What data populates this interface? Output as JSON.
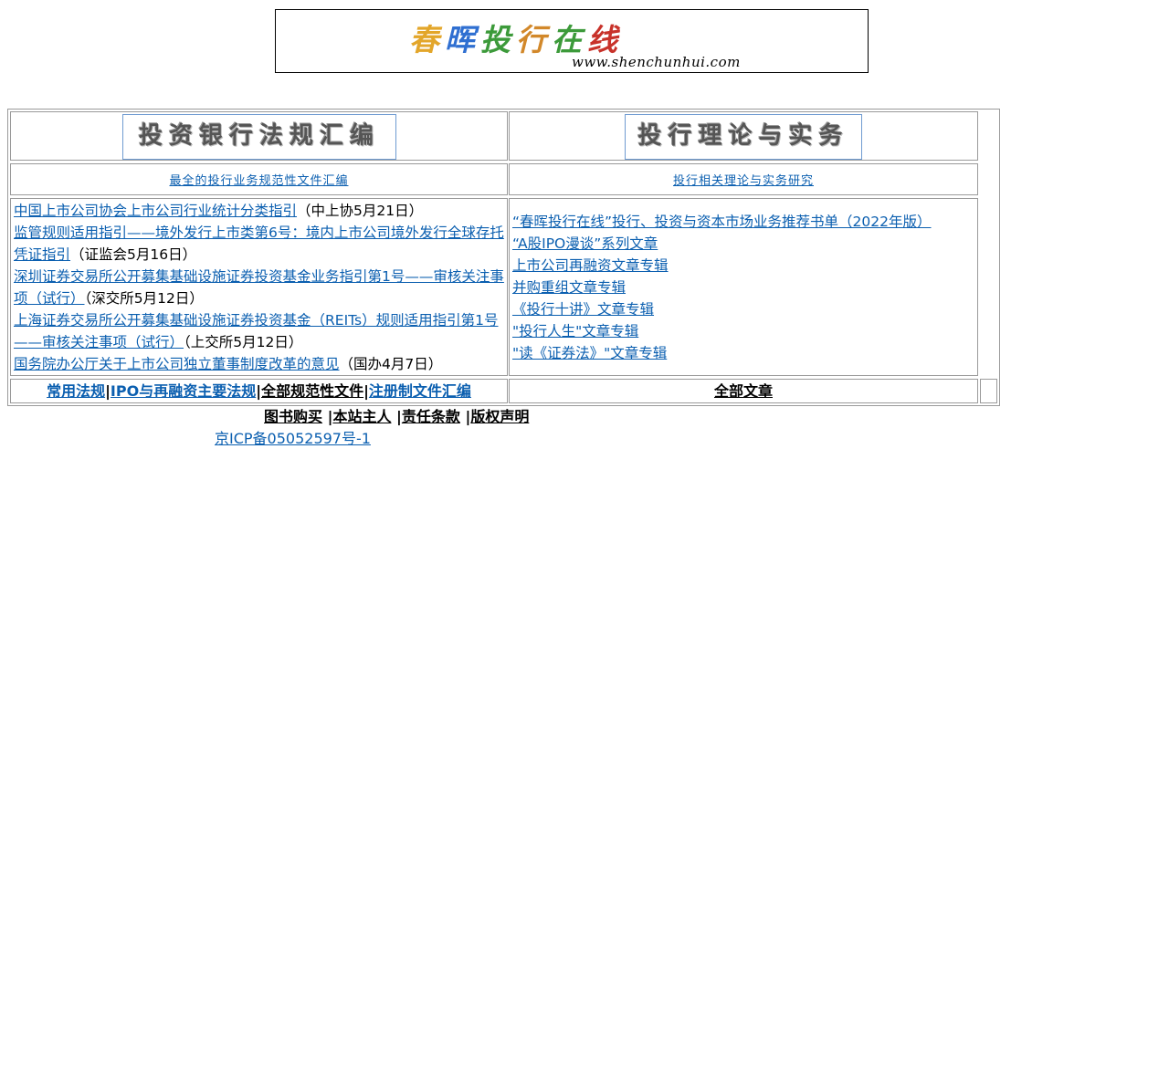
{
  "banner": {
    "logo_text": "春晖投行在线",
    "logo_colors": [
      "#e3a62a",
      "#2f6fd1",
      "#3c9a3a",
      "#d2882a",
      "#3c9a3a",
      "#c8322a"
    ],
    "url_text": "www.shenchunhui.com"
  },
  "left": {
    "title": "投资银行法规汇编",
    "subtitle": "最全的投行业务规范性文件汇编",
    "items": [
      {
        "link": "中国上市公司协会上市公司行业统计分类指引",
        "note": "（中上协5月21日）"
      },
      {
        "link": "监管规则适用指引——境外发行上市类第6号：境内上市公司境外发行全球存托凭证指引",
        "note": "（证监会5月16日）"
      },
      {
        "link": "深圳证券交易所公开募集基础设施证券投资基金业务指引第1号——审核关注事项（试行）",
        "note": "（深交所5月12日）"
      },
      {
        "link": "上海证券交易所公开募集基础设施证券投资基金（REITs）规则适用指引第1号——审核关注事项（试行）",
        "note": "（上交所5月12日）"
      },
      {
        "link": "国务院办公厅关于上市公司独立董事制度改革的意见",
        "note": "（国办4月7日）"
      }
    ],
    "bottom": {
      "link1": "常用法规",
      "link2": "IPO与再融资主要法规",
      "link3": "全部规范性文件",
      "link4": "注册制文件汇编",
      "sep": "|"
    }
  },
  "right": {
    "title": "投行理论与实务",
    "subtitle": "投行相关理论与实务研究",
    "items": [
      "“春晖投行在线”投行、投资与资本市场业务推荐书单（2022年版）",
      "“A股IPO漫谈”系列文章",
      "上市公司再融资文章专辑",
      "并购重组文章专辑",
      "《投行十讲》文章专辑",
      "\"投行人生\"文章专辑",
      "\"读《证券法》\"文章专辑"
    ],
    "bottom": {
      "link": "全部文章"
    }
  },
  "footer": {
    "link1": "图书购买",
    "link2": "本站主人",
    "link3": "责任条款",
    "link4": "版权声明",
    "sep": "|",
    "icp": "京ICP备05052597号-1"
  }
}
